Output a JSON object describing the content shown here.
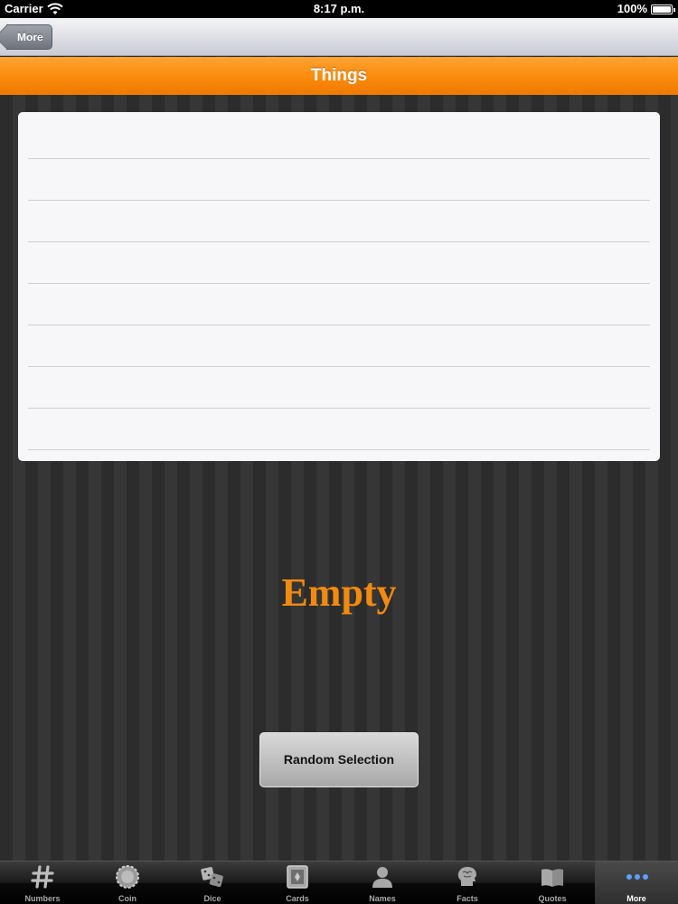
{
  "status_bar": {
    "carrier": "Carrier",
    "time": "8:17 p.m.",
    "battery": "100%"
  },
  "nav_bar": {
    "back_label": "More"
  },
  "title_bar": {
    "title": "Things"
  },
  "result": {
    "text": "Empty"
  },
  "random_button": {
    "label": "Random Selection"
  },
  "tab_bar": {
    "items": [
      {
        "label": "Numbers",
        "icon": "hash-icon"
      },
      {
        "label": "Coin",
        "icon": "coin-icon"
      },
      {
        "label": "Dice",
        "icon": "dice-icon"
      },
      {
        "label": "Cards",
        "icon": "cards-icon"
      },
      {
        "label": "Names",
        "icon": "person-icon"
      },
      {
        "label": "Facts",
        "icon": "brain-icon"
      },
      {
        "label": "Quotes",
        "icon": "book-icon"
      },
      {
        "label": "More",
        "icon": "more-dots-icon",
        "selected": true
      }
    ]
  },
  "colors": {
    "accent": "#f28a0f",
    "title_bar": "#fb8a0c",
    "tab_selected": "#5aa0ff"
  }
}
